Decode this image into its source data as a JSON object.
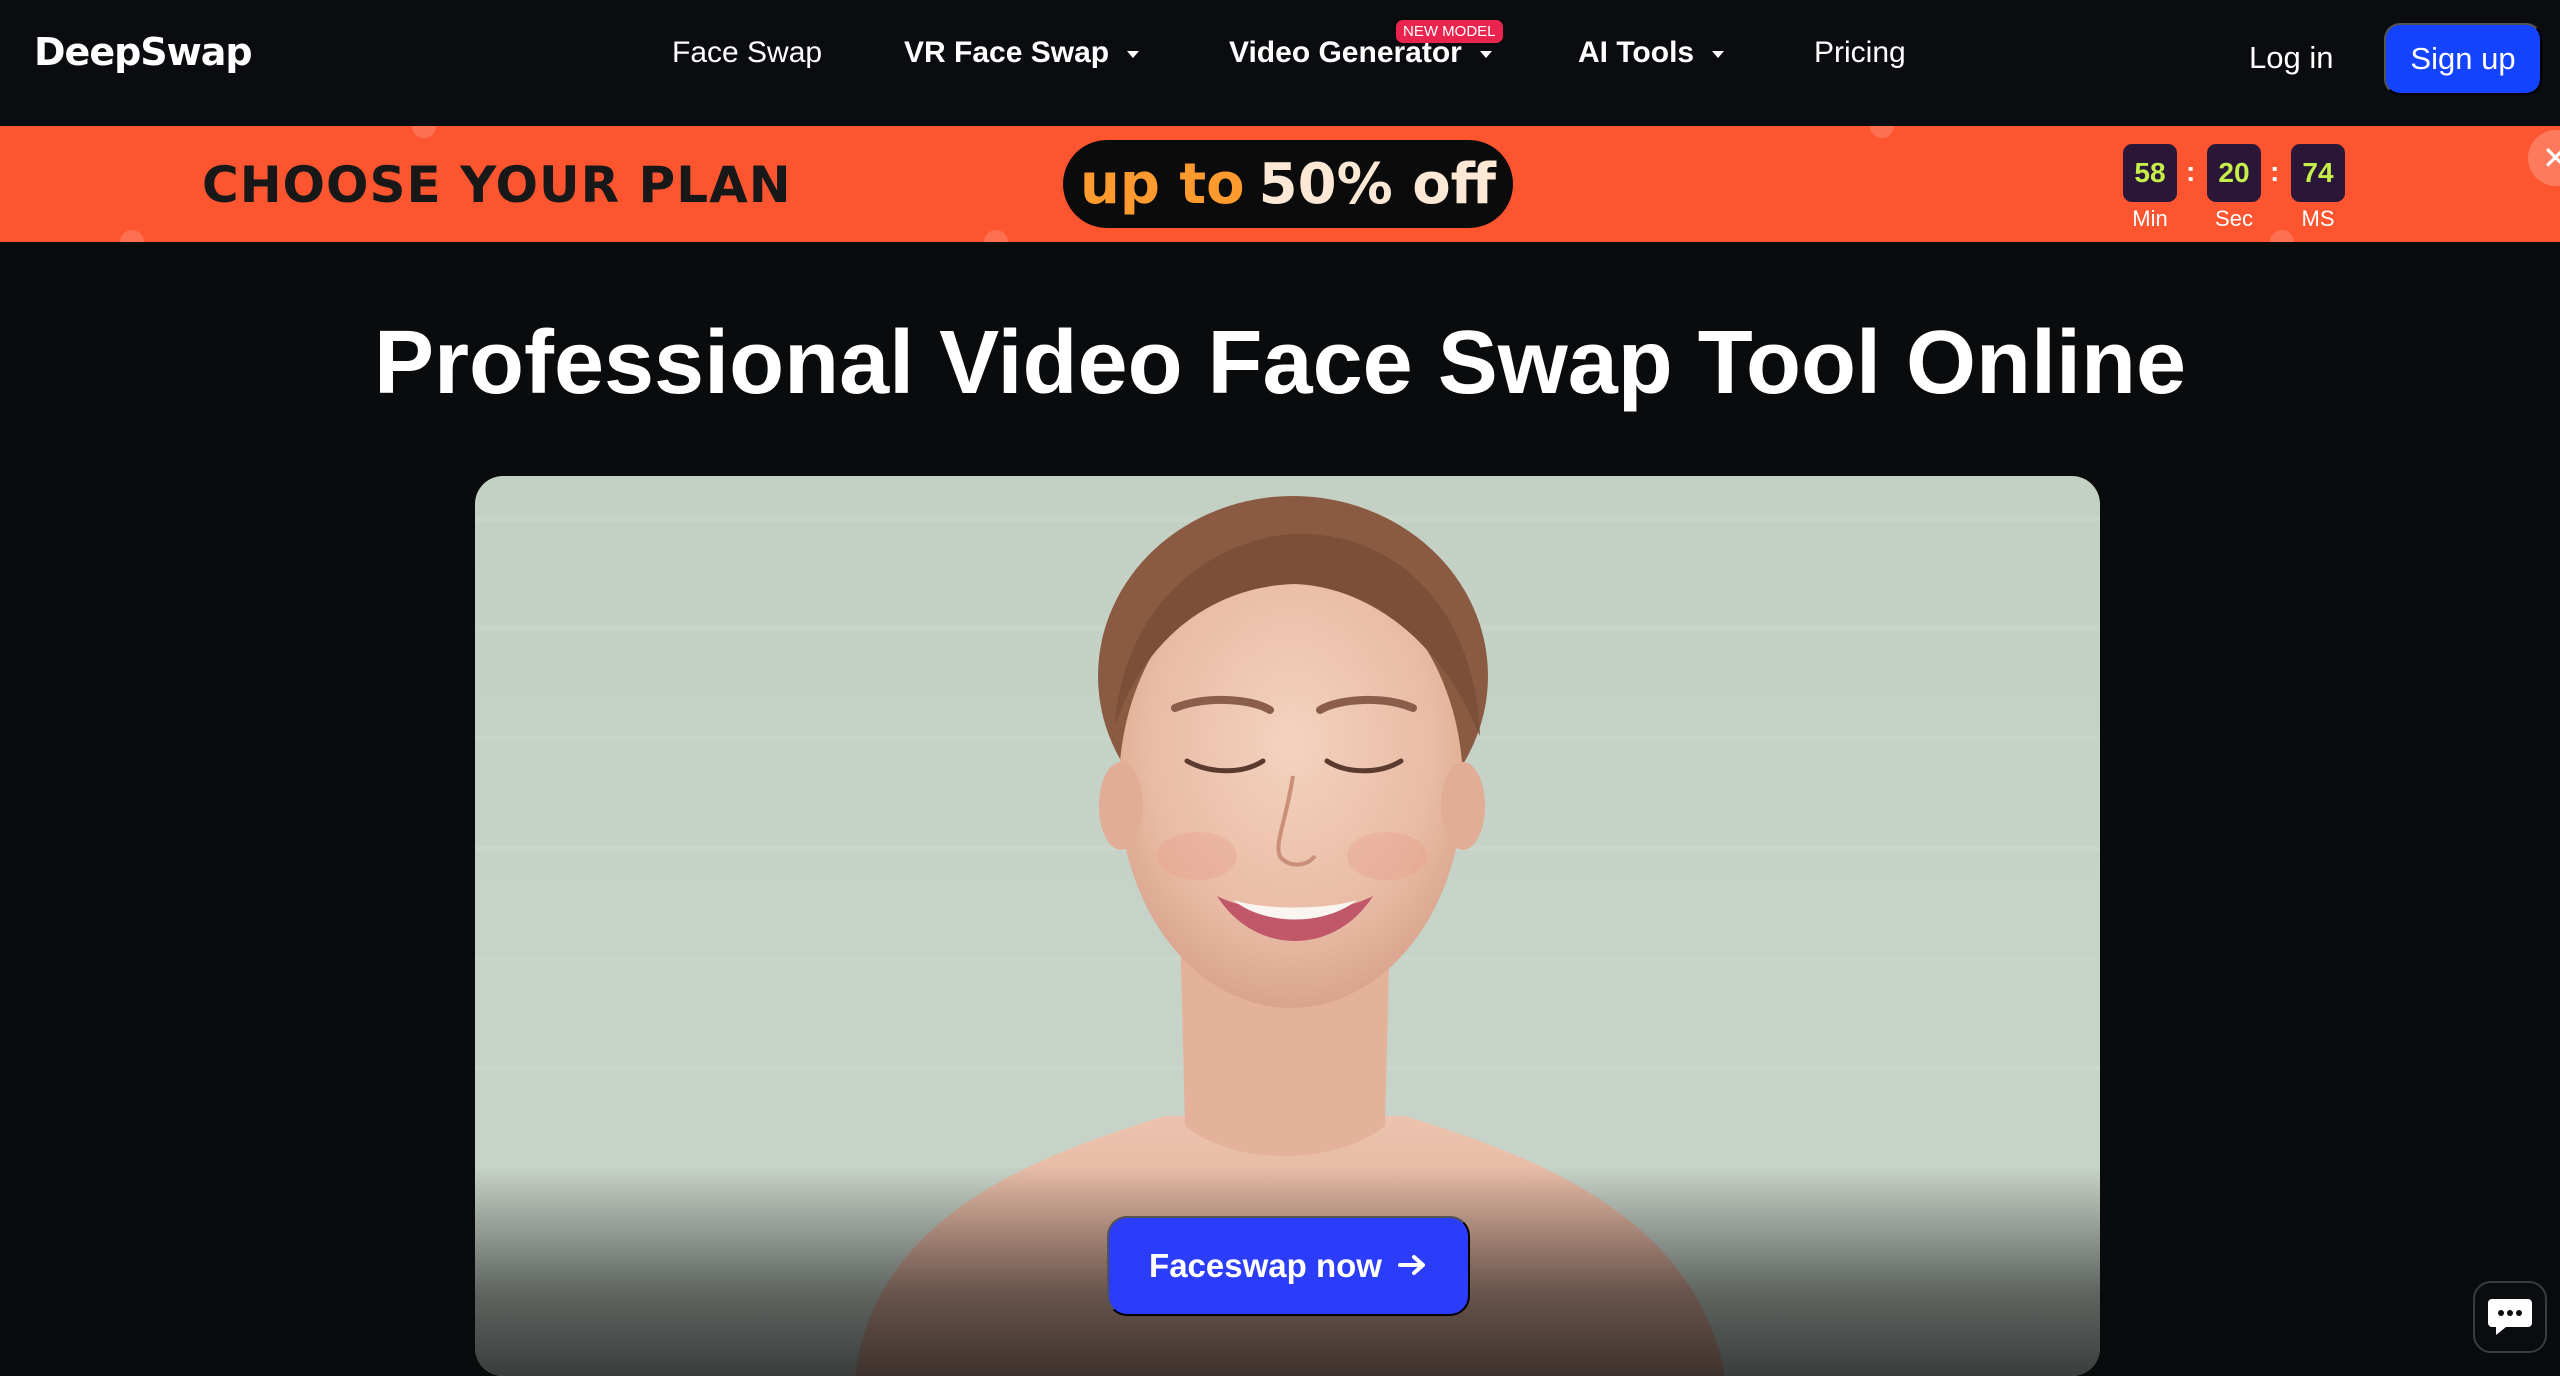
{
  "header": {
    "logo": "DeepSwap",
    "nav": [
      {
        "label": "Face Swap"
      },
      {
        "label": "VR Face Swap"
      },
      {
        "label": "Video Generator",
        "badge": "NEW MODEL"
      },
      {
        "label": "AI Tools"
      },
      {
        "label": "Pricing"
      }
    ],
    "login_label": "Log in",
    "signup_label": "Sign up"
  },
  "promo": {
    "title": "CHOOSE YOUR PLAN",
    "discount_prefix": "up to",
    "discount_value": "50% off",
    "timer": [
      {
        "value": "58",
        "label": "Min"
      },
      {
        "value": "20",
        "label": "Sec"
      },
      {
        "value": "74",
        "label": "MS"
      }
    ],
    "close_icon": "close-icon"
  },
  "hero": {
    "title": "Professional Video Face Swap Tool Online",
    "cta_label": "Faceswap now",
    "cta_icon": "arrow-right-icon"
  },
  "chat": {
    "icon": "chat-bubble-icon"
  },
  "colors": {
    "brand_blue": "#1443ff",
    "cta_blue": "#2c3dfa",
    "promo_orange": "#fd5530",
    "badge_red": "#e8244f",
    "timer_green": "#c6ee4b",
    "background": "#0a0b0d"
  }
}
